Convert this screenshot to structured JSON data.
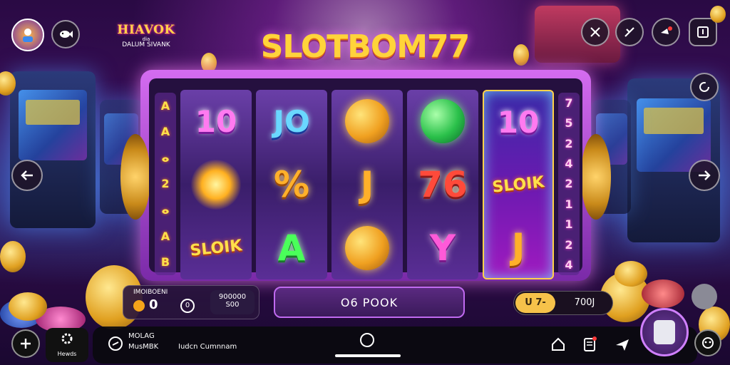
{
  "header": {
    "logo_line1": "HIAVOK",
    "logo_line2": "dia",
    "logo_line3": "DALUM SIVANK",
    "title": "SLOTBOM77"
  },
  "reels": [
    {
      "symbols": [
        "10",
        "sun",
        "SLOIK"
      ]
    },
    {
      "symbols": [
        "JO",
        "%",
        "A"
      ]
    },
    {
      "symbols": [
        "coin",
        "J",
        "coin"
      ]
    },
    {
      "symbols": [
        "coin-green",
        "76",
        "Y"
      ]
    },
    {
      "symbols": [
        "10",
        "SLOIK",
        "J"
      ]
    }
  ],
  "left_column": [
    "A",
    "A",
    "ⴰ",
    "2",
    "ⴰ",
    "A",
    "B"
  ],
  "right_column": [
    "7",
    "5",
    "2",
    "4",
    "2",
    "1",
    "1",
    "2",
    "4"
  ],
  "bet": {
    "label": "IMOIBOENI",
    "value": "0",
    "circle": "0",
    "box_line1": "900000",
    "box_line2": "S00"
  },
  "spin_label": "O6 POOK",
  "win": {
    "left": "U 7-",
    "right": "700J"
  },
  "bottom": {
    "item1_label": "Hewds",
    "item2_line1": "MOLAG",
    "item2_line2": "MusMBK",
    "item3_label": "Iudcn Cumnnam"
  },
  "icons": {
    "top_left": [
      "avatar",
      "fish-icon"
    ],
    "top_right": [
      "cross-icon",
      "x-icon",
      "notification-icon",
      "info-icon"
    ],
    "nav": [
      "arrow-left-icon",
      "arrow-right-icon"
    ]
  },
  "colors": {
    "accent_gold": "#ffd43a",
    "accent_purple": "#c06af0"
  }
}
